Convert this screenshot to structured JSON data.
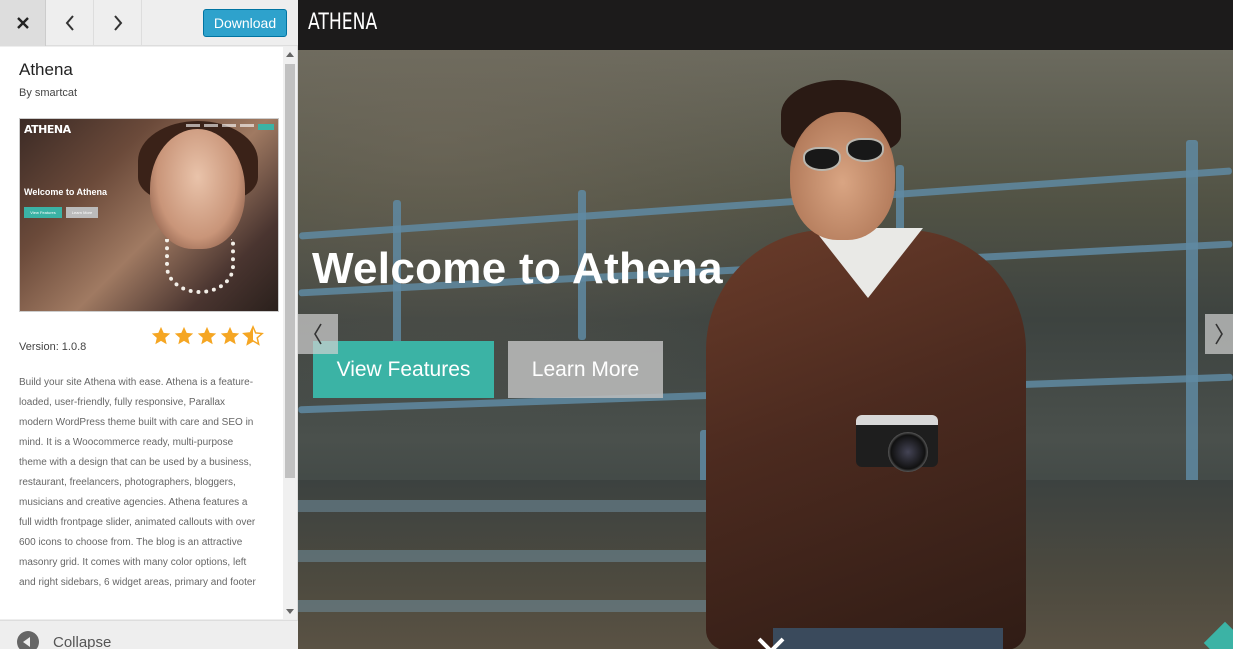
{
  "toolbar": {
    "close_icon": "close-icon",
    "prev_icon": "chevron-left-icon",
    "next_icon": "chevron-right-icon",
    "download_label": "Download"
  },
  "theme": {
    "name": "Athena",
    "author": "By smartcat",
    "version": "Version: 1.0.8",
    "rating_stars": 4.5,
    "description": "Build your site Athena with ease. Athena is a feature-loaded, user-friendly, fully responsive, Parallax modern WordPress theme built with care and SEO in mind. It is a Woocommerce ready, multi-purpose theme with a design that can be used by a business, restaurant, freelancers, photographers, bloggers, musicians and creative agencies. Athena features a full width frontpage slider, animated callouts with over 600 icons to choose from. The blog is an attractive masonry grid. It comes with many color options, left and right sidebars, 6 widget areas, primary and footer"
  },
  "thumbnail": {
    "logo": "ATHENA",
    "title": "Welcome to Athena",
    "button_primary": "View Features",
    "button_secondary": "Learn More"
  },
  "footer": {
    "collapse_label": "Collapse"
  },
  "preview": {
    "site_logo": "ATHENA",
    "hero_title": "Welcome to Athena",
    "button_primary": "View Features",
    "button_secondary": "Learn More",
    "accent_color": "#3bb3a5"
  }
}
